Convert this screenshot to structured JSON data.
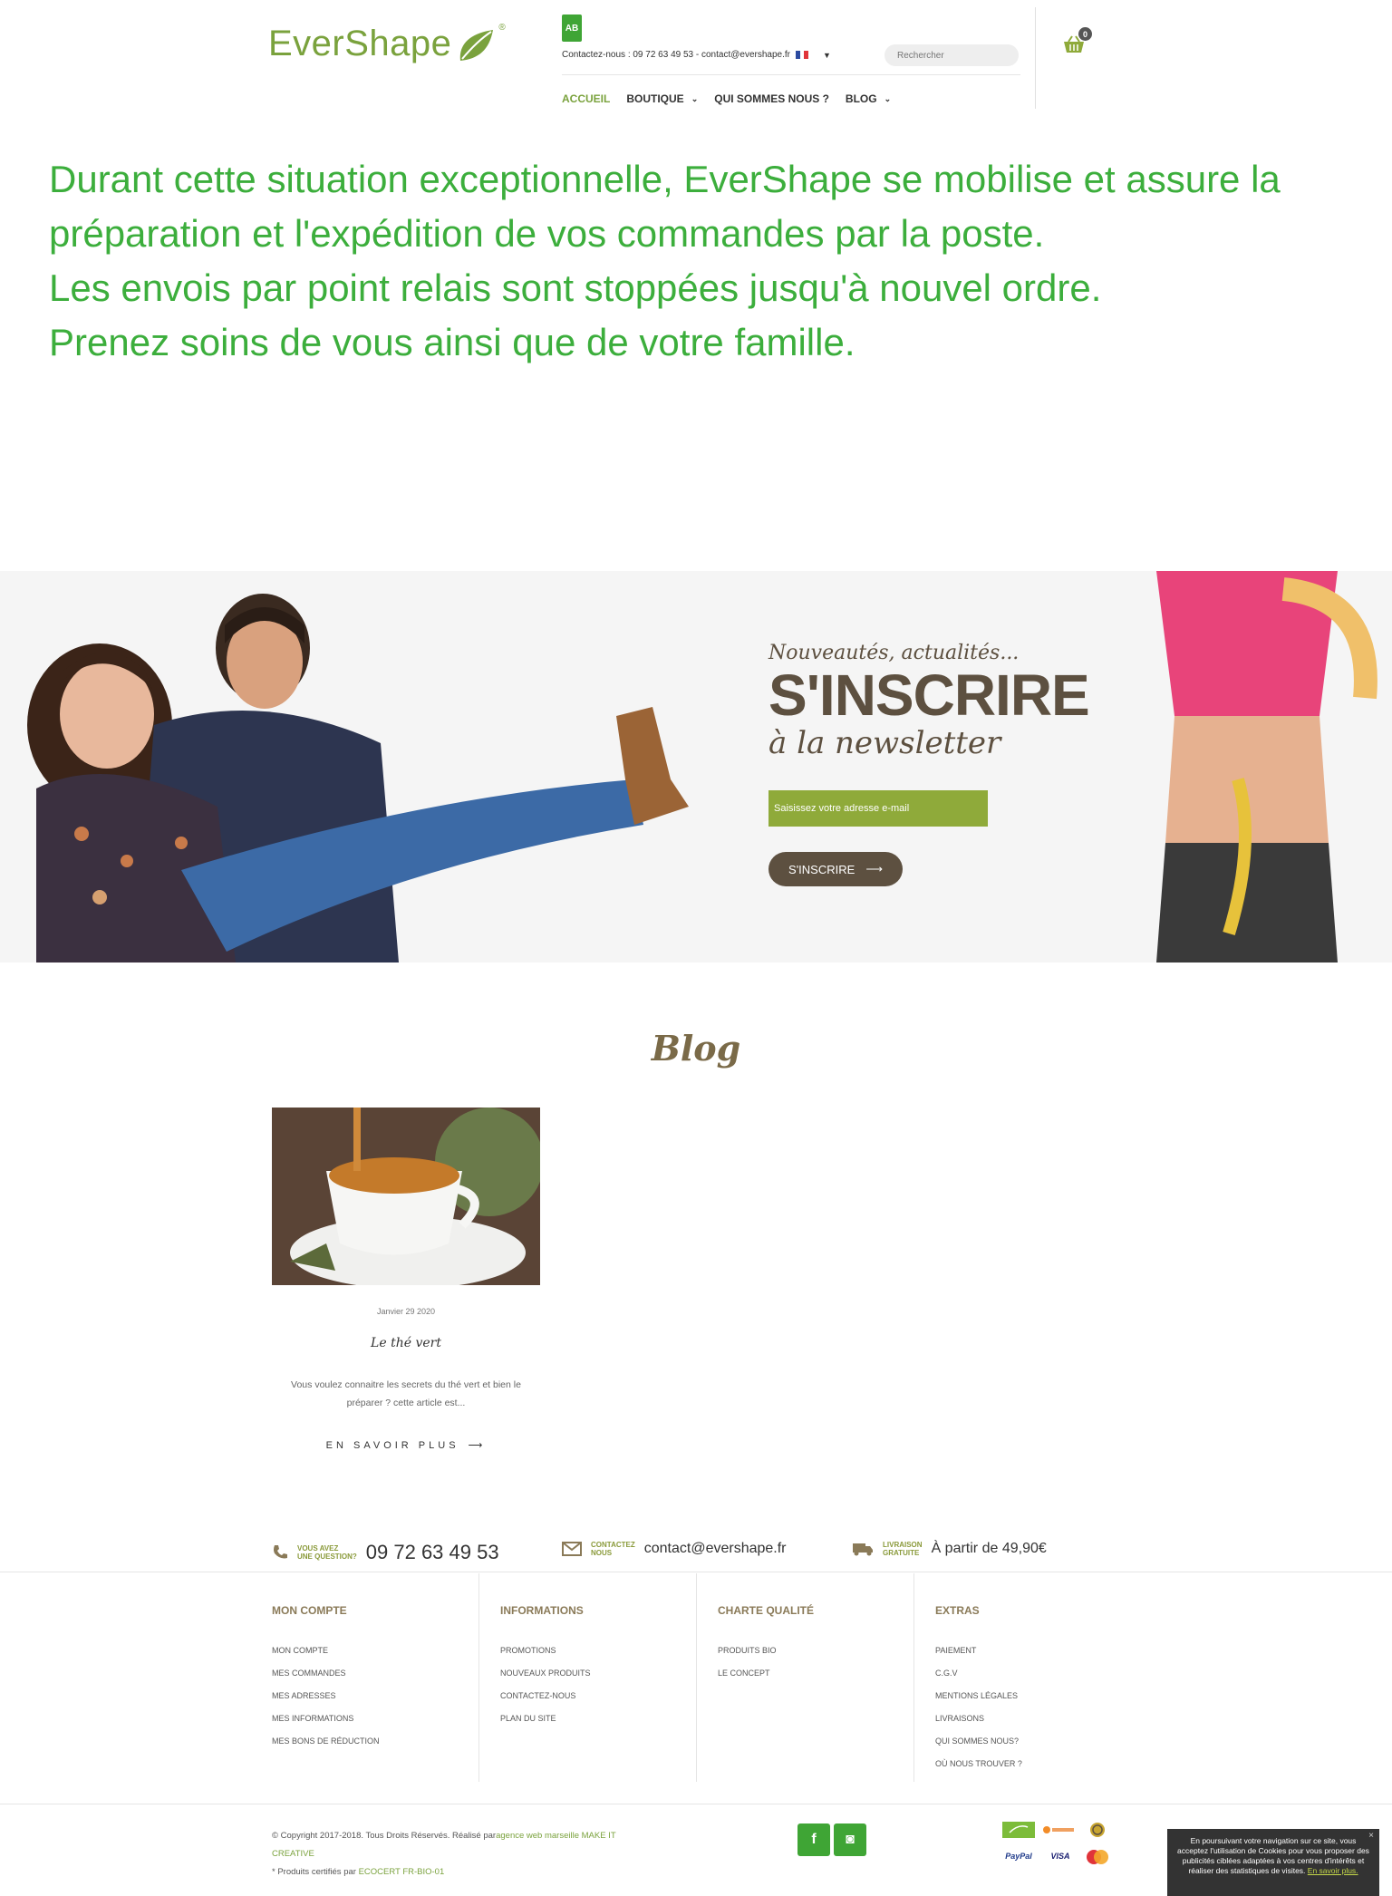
{
  "header": {
    "logo_text": "EverShape",
    "logo_reg": "®",
    "ab_badge": "AB",
    "contact_line": "Contactez-nous : 09 72 63 49 53 - contact@evershape.fr",
    "search_placeholder": "Rechercher",
    "cart_count": "0"
  },
  "nav": {
    "items": [
      {
        "label": "ACCUEIL"
      },
      {
        "label": "BOUTIQUE"
      },
      {
        "label": "QUI SOMMES NOUS ?"
      },
      {
        "label": "BLOG"
      }
    ]
  },
  "announcement": {
    "line1": "Durant cette situation exceptionnelle, EverShape se mobilise et assure la préparation et l'expédition de vos commandes par la poste.",
    "line2": "Les envois par point relais sont stoppées jusqu'à nouvel ordre.",
    "line3": "Prenez soins de vous ainsi que de votre famille."
  },
  "newsletter": {
    "tagline": "Nouveautés, actualités...",
    "title": "S'INSCRIRE",
    "subtitle": "à la newsletter",
    "input_placeholder": "Saisissez votre adresse e-mail",
    "button_label": "S'INSCRIRE"
  },
  "blog": {
    "title": "Blog",
    "post": {
      "date": "Janvier 29 2020",
      "title": "Le thé vert",
      "excerpt": "Vous voulez connaitre les secrets du thé vert et bien le préparer ? cette article est...",
      "more": "EN SAVOIR PLUS"
    }
  },
  "strip": {
    "question_label_1": "VOUS AVEZ",
    "question_label_2": "UNE QUESTION?",
    "phone": "09 72 63 49 53",
    "contact_label_1": "CONTACTEZ",
    "contact_label_2": "NOUS",
    "email": "contact@evershape.fr",
    "delivery_label_1": "LIVRAISON",
    "delivery_label_2": "GRATUITE",
    "delivery_value": "À partir de 49,90€"
  },
  "footer": {
    "columns": [
      {
        "title": "MON COMPTE",
        "links": [
          "MON COMPTE",
          "MES COMMANDES",
          "MES ADRESSES",
          "MES INFORMATIONS",
          "MES BONS DE RÉDUCTION"
        ]
      },
      {
        "title": "INFORMATIONS",
        "links": [
          "PROMOTIONS",
          "NOUVEAUX PRODUITS",
          "CONTACTEZ-NOUS",
          "PLAN DU SITE"
        ]
      },
      {
        "title": "CHARTE QUALITÉ",
        "links": [
          "PRODUITS BIO",
          "LE CONCEPT"
        ]
      },
      {
        "title": "EXTRAS",
        "links": [
          "PAIEMENT",
          "C.G.V",
          "MENTIONS LÉGALES",
          "LIVRAISONS",
          "QUI SOMMES NOUS?",
          "OÙ NOUS TROUVER ?"
        ]
      }
    ],
    "copyright_prefix": "© Copyright 2017-2018. Tous Droits Réservés. Réalisé par",
    "agency_link": "agence web marseille MAKE IT CREATIVE",
    "certified_prefix": "* Produits certifiés par ",
    "certified_link": "ECOCERT FR-BIO-01",
    "social": {
      "facebook": "f",
      "instagram": "◙"
    },
    "payment": [
      "PayPal",
      "VISA"
    ]
  },
  "cookie": {
    "text": "En poursuivant votre navigation sur ce site, vous acceptez l'utilisation de Cookies pour vous proposer des publicités ciblées adaptées à vos centres d'intérêts et réaliser des statistiques de visites.",
    "more": "En savoir plus.",
    "close": "×"
  },
  "colors": {
    "brand_green": "#7aa23d",
    "announce_green": "#3cae3c",
    "brown": "#5d5040",
    "newsletter_input": "#8faa3a"
  }
}
